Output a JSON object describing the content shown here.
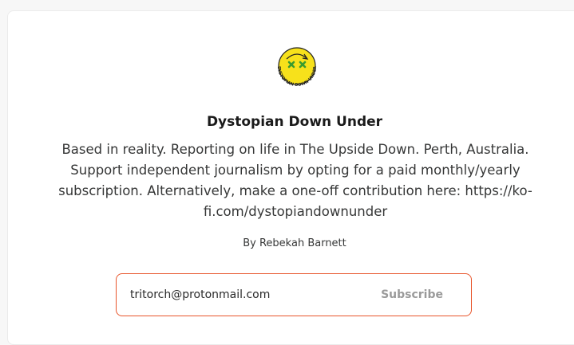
{
  "publication": {
    "name": "Dystopian Down Under",
    "logo_text": "DYSTOPIAN DOWN UNDER",
    "logo_icon": "dizzy-face-logo",
    "description": "Based in reality. Reporting on life in The Upside Down. Perth, Australia. Support independent journalism by opting for a paid monthly/yearly subscription. Alternatively, make a one-off contribution here: https://ko-fi.com/dystopiandownunder",
    "author": "By Rebekah Barnett"
  },
  "subscribe_form": {
    "email_value": "tritorch@protonmail.com",
    "button_label": "Subscribe"
  },
  "colors": {
    "accent": "#e8552b",
    "logo_yellow": "#f7e11b",
    "logo_green": "#3a9b2e"
  }
}
